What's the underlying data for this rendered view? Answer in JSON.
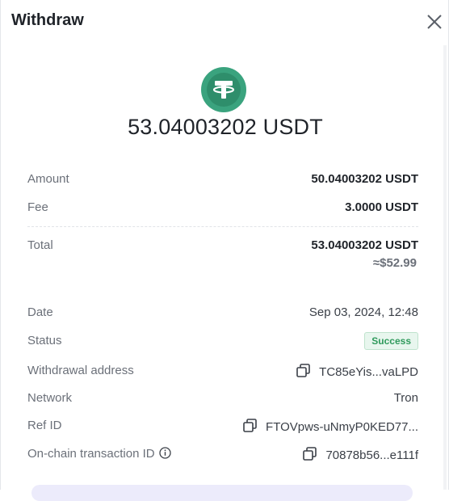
{
  "dialog": {
    "title": "Withdraw",
    "close_icon": "close-icon",
    "coin_icon": "usdt-tether-icon",
    "total_amount_display": "53.04003202 USDT",
    "accent_color": "#3aa37e"
  },
  "summary": {
    "amount_label": "Amount",
    "amount_value": "50.04003202 USDT",
    "fee_label": "Fee",
    "fee_value": "3.0000 USDT",
    "total_label": "Total",
    "total_value": "53.04003202 USDT",
    "total_fiat": "≈$52.99"
  },
  "details": {
    "date_label": "Date",
    "date_value": "Sep 03, 2024, 12:48",
    "status_label": "Status",
    "status_value": "Success",
    "address_label": "Withdrawal address",
    "address_value": "TC85eYis...vaLPD",
    "network_label": "Network",
    "network_value": "Tron",
    "ref_label": "Ref ID",
    "ref_value": "FTOVpws-uNmyP0KED77...",
    "txid_label": "On-chain transaction ID",
    "txid_value": "70878b56...e111f"
  }
}
